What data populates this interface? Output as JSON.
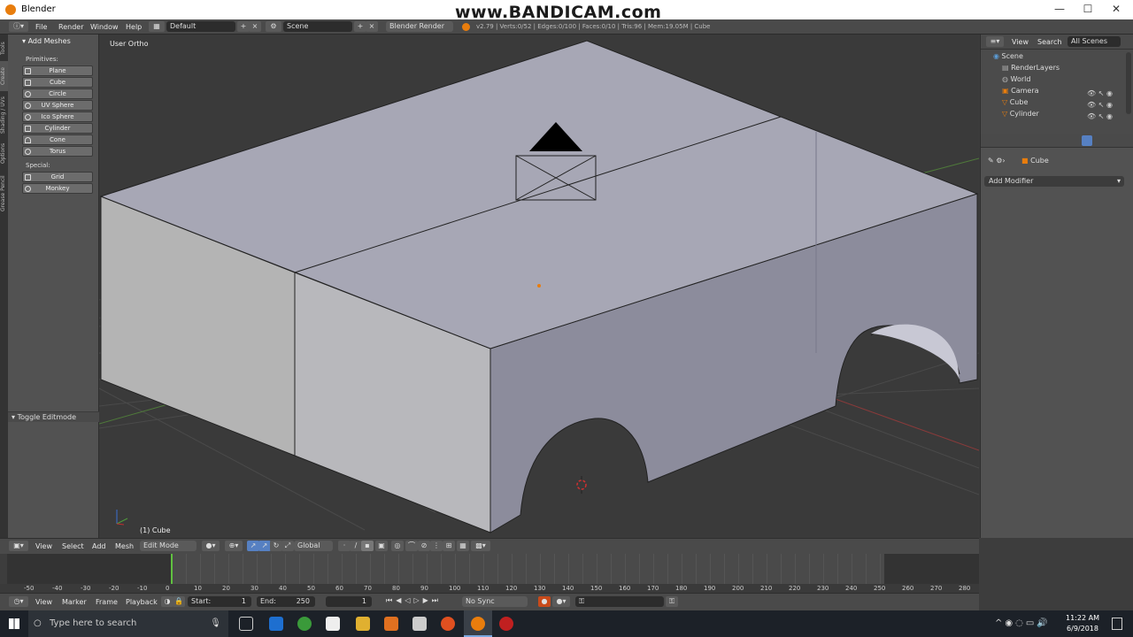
{
  "window": {
    "title": "Blender",
    "watermark": "www.BANDICAM.com"
  },
  "menubar": {
    "items": [
      "File",
      "Render",
      "Window",
      "Help"
    ],
    "layout": "Default",
    "scene": "Scene",
    "engine": "Blender Render",
    "stats": "v2.79 | Verts:0/52 | Edges:0/100 | Faces:0/10 | Tris:96 | Mem:19.05M | Cube"
  },
  "toolshelf": {
    "tabs": [
      "Tools",
      "Create",
      "Shading / UVs",
      "Options",
      "Grease Pencil"
    ],
    "panel_title": "Add Meshes",
    "primitives_label": "Primitives:",
    "primitives": [
      "Plane",
      "Cube",
      "Circle",
      "UV Sphere",
      "Ico Sphere",
      "Cylinder",
      "Cone",
      "Torus"
    ],
    "special_label": "Special:",
    "special": [
      "Grid",
      "Monkey"
    ],
    "toggle_editmode": "Toggle Editmode"
  },
  "viewport": {
    "view_label": "User Ortho",
    "object_label": "(1) Cube"
  },
  "outliner": {
    "menu": [
      "View",
      "Search"
    ],
    "filter": "All Scenes",
    "items": [
      "Scene",
      "RenderLayers",
      "World",
      "Camera",
      "Cube",
      "Cylinder"
    ]
  },
  "properties": {
    "object": "Cube",
    "add_modifier": "Add Modifier"
  },
  "view3d_header": {
    "menus": [
      "View",
      "Select",
      "Add",
      "Mesh"
    ],
    "mode": "Edit Mode",
    "orientation": "Global"
  },
  "timeline": {
    "ticks": [
      "-50",
      "-40",
      "-30",
      "-20",
      "-10",
      "0",
      "10",
      "20",
      "30",
      "40",
      "50",
      "60",
      "70",
      "80",
      "90",
      "100",
      "110",
      "120",
      "130",
      "140",
      "150",
      "160",
      "170",
      "180",
      "190",
      "200",
      "210",
      "220",
      "230",
      "240",
      "250",
      "260",
      "270",
      "280"
    ],
    "menus": [
      "View",
      "Marker",
      "Frame",
      "Playback"
    ],
    "start_label": "Start:",
    "start": "1",
    "end_label": "End:",
    "end": "250",
    "current": "1",
    "sync": "No Sync"
  },
  "taskbar": {
    "search_placeholder": "Type here to search",
    "time": "11:22 AM",
    "date": "6/9/2018"
  },
  "colors": {
    "accent": "#5680c2",
    "mesh": "#8f8fa0",
    "blender_orange": "#e87d0d"
  }
}
